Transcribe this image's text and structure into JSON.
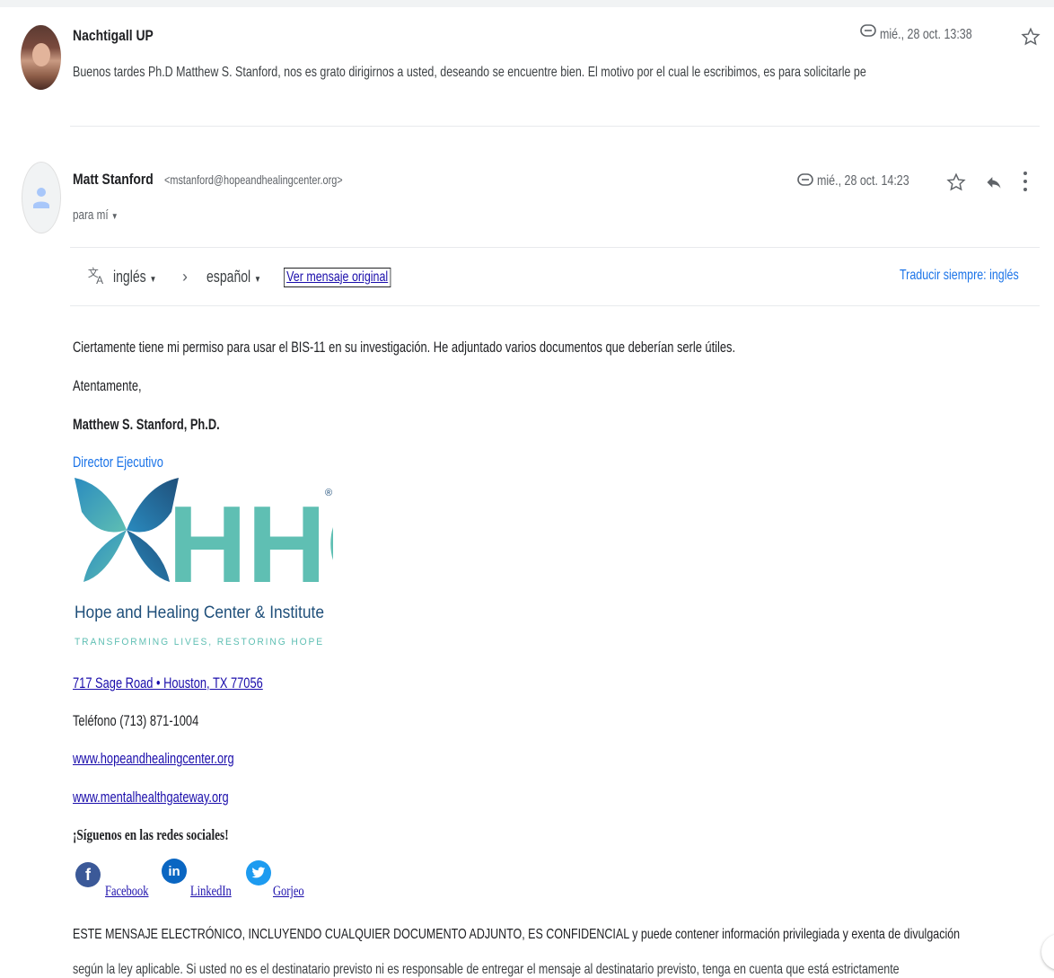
{
  "thread": {
    "message1": {
      "sender": "Nachtigall UP",
      "date": "mié., 28 oct. 13:38",
      "snippet": "Buenos tardes Ph.D Matthew S. Stanford, nos es grato dirigirnos a usted, deseando se encuentre bien. El motivo por el cual le escribimos, es para solicitarle pe"
    },
    "message2": {
      "sender": "Matt Stanford",
      "email": "<mstanford@hopeandhealingcenter.org>",
      "date": "mié., 28 oct. 14:23",
      "recipient": "para mí",
      "translate": {
        "source_lang": "inglés",
        "target_lang": "español",
        "view_original": "Ver mensaje original",
        "always_translate": "Traducir siempre: inglés"
      },
      "body": {
        "line1": "Ciertamente tiene mi permiso para usar el BIS-11 en su investigación. He adjuntado varios documentos que deberían serle útiles.",
        "closing": "Atentamente,",
        "signature_name": "Matthew S. Stanford, Ph.D.",
        "signature_title": "Director Ejecutivo",
        "logo_text": "HHCI",
        "logo_registered": "®",
        "logo_org": "Hope and Healing Center & Institute",
        "logo_tagline": "TRANSFORMING LIVES, RESTORING HOPE",
        "address": "717 Sage Road • Houston, TX 77056",
        "phone": "Teléfono (713) 871-1004",
        "website1": "www.hopeandhealingcenter.org",
        "website2": "www.mentalhealthgateway.org",
        "social_heading": "¡Síguenos en las redes sociales!",
        "social": {
          "facebook": "Facebook",
          "linkedin": "LinkedIn",
          "twitter": "Gorjeo"
        },
        "disclaimer1": "ESTE MENSAJE ELECTRÓNICO, INCLUYENDO CUALQUIER DOCUMENTO ADJUNTO, ES CONFIDENCIAL y puede contener información privilegiada y exenta de divulgación",
        "disclaimer2": "según la ley aplicable. Si usted no es el destinatario previsto ni es responsable de entregar el mensaje al destinatario previsto, tenga en cuenta que está estrictamente"
      }
    }
  },
  "colors": {
    "link": "#1a0dab",
    "accent_blue": "#1a73e8",
    "logo_teal": "#5fbfb3",
    "logo_navy": "#1f4f7a"
  }
}
